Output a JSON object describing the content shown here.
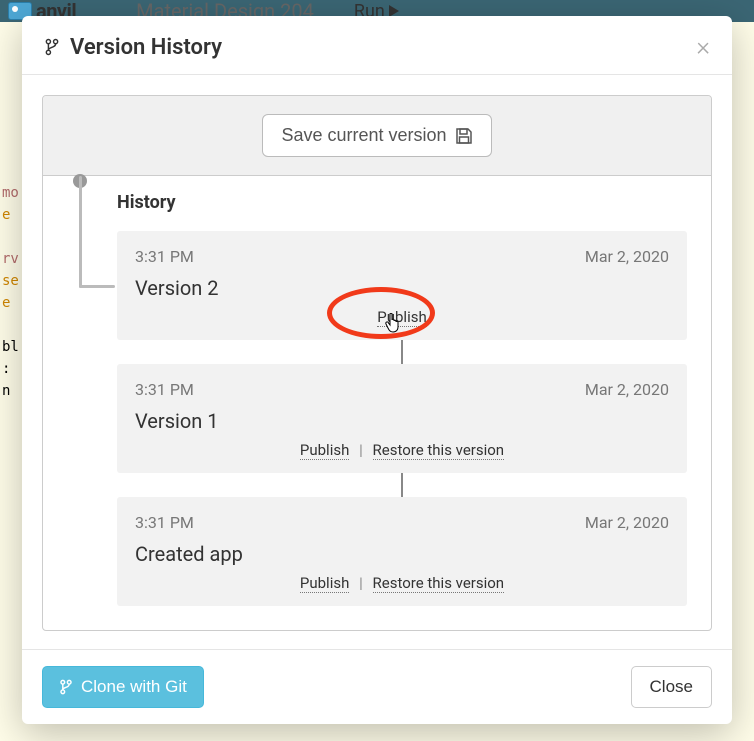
{
  "background": {
    "brand": "anvil",
    "app_name": "Material Design 204",
    "run_label": "Run",
    "code_snips": [
      "mo",
      "e",
      "rv",
      "se",
      "e",
      "bl",
      ":",
      "n"
    ]
  },
  "modal": {
    "title": "Version History",
    "close_glyph": "×",
    "save_button": "Save current version",
    "history_heading": "History",
    "clone_button": "Clone with Git",
    "footer_close": "Close"
  },
  "actions": {
    "publish": "Publish",
    "restore": "Restore this version"
  },
  "versions": [
    {
      "time": "3:31 PM",
      "date": "Mar 2, 2020",
      "name": "Version 2",
      "is_current": true
    },
    {
      "time": "3:31 PM",
      "date": "Mar 2, 2020",
      "name": "Version 1",
      "is_current": false
    },
    {
      "time": "3:31 PM",
      "date": "Mar 2, 2020",
      "name": "Created app",
      "is_current": false
    }
  ],
  "highlight": {
    "target": "publish-link-version-2"
  }
}
